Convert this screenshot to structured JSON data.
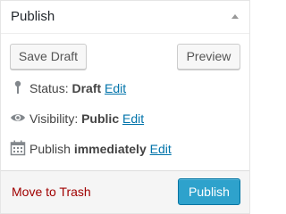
{
  "panel": {
    "title": "Publish"
  },
  "buttons": {
    "save_draft": "Save Draft",
    "preview": "Preview",
    "publish": "Publish",
    "move_to_trash": "Move to Trash"
  },
  "status": {
    "label": "Status:",
    "value": "Draft",
    "edit": "Edit",
    "icon": "pin-icon"
  },
  "visibility": {
    "label": "Visibility:",
    "value": "Public",
    "edit": "Edit",
    "icon": "eye-icon"
  },
  "schedule": {
    "label": "Publish",
    "value": "immediately",
    "edit": "Edit",
    "icon": "calendar-icon"
  },
  "colors": {
    "link": "#0073aa",
    "trash": "#a00000",
    "primary_button": "#2ea2cc"
  }
}
